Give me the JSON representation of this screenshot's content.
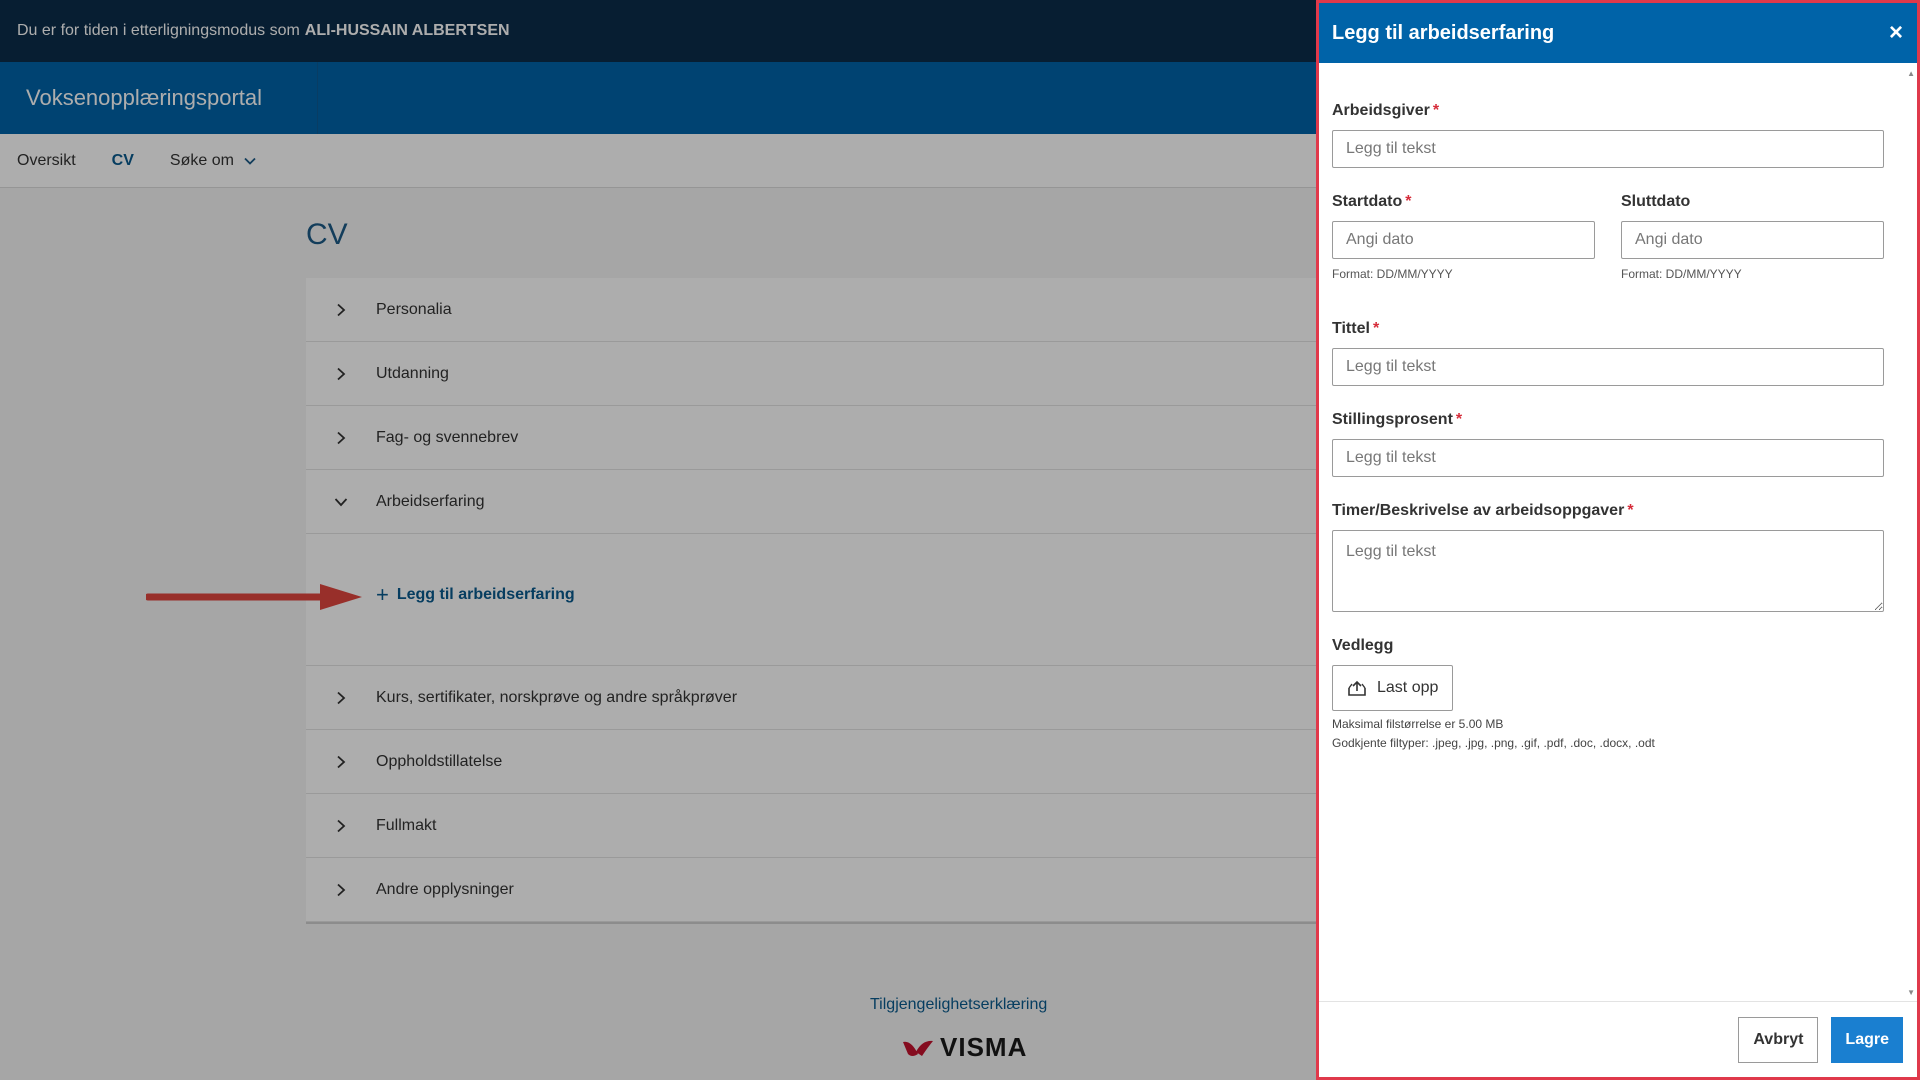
{
  "impersonation": {
    "prefix": "Du er for tiden i etterligningsmodus som",
    "name": "ALI-HUSSAIN ALBERTSEN"
  },
  "portal": {
    "title": "Voksenopplæringsportal"
  },
  "nav": {
    "items": [
      {
        "label": "Oversikt"
      },
      {
        "label": "CV"
      },
      {
        "label": "Søke om"
      }
    ]
  },
  "page": {
    "title": "CV"
  },
  "accordion": {
    "items": [
      {
        "label": "Personalia"
      },
      {
        "label": "Utdanning"
      },
      {
        "label": "Fag- og svennebrev"
      },
      {
        "label": "Arbeidserfaring"
      },
      {
        "label": "Kurs, sertifikater, norskprøve og andre språkprøver"
      },
      {
        "label": "Oppholdstillatelse"
      },
      {
        "label": "Fullmakt"
      },
      {
        "label": "Andre opplysninger"
      }
    ],
    "add_link": "Legg til arbeidserfaring"
  },
  "footer": {
    "link": "Tilgjengelighetserklæring",
    "logo": "VISMA"
  },
  "panel": {
    "title": "Legg til arbeidserfaring",
    "close": "×",
    "fields": {
      "employer": {
        "label": "Arbeidsgiver",
        "placeholder": "Legg til tekst"
      },
      "start": {
        "label": "Startdato",
        "placeholder": "Angi dato",
        "hint": "Format: DD/MM/YYYY"
      },
      "end": {
        "label": "Sluttdato",
        "placeholder": "Angi dato",
        "hint": "Format: DD/MM/YYYY"
      },
      "title": {
        "label": "Tittel",
        "placeholder": "Legg til tekst"
      },
      "percent": {
        "label": "Stillingsprosent",
        "placeholder": "Legg til tekst"
      },
      "description": {
        "label": "Timer/Beskrivelse av arbeidsoppgaver",
        "placeholder": "Legg til tekst"
      }
    },
    "attachments": {
      "label": "Vedlegg",
      "upload": "Last opp",
      "max_size": "Maksimal filstørrelse er 5.00 MB",
      "types": "Godkjente filtyper: .jpeg, .jpg, .png, .gif, .pdf, .doc, .docx, .odt"
    },
    "required_mark": "*",
    "buttons": {
      "cancel": "Avbryt",
      "save": "Lagre"
    }
  },
  "colors": {
    "header": "#0b2d4a",
    "brand": "#0063a8",
    "accent": "#1a7fd0",
    "required": "#d62c3a",
    "highlight": "#e0394b"
  }
}
